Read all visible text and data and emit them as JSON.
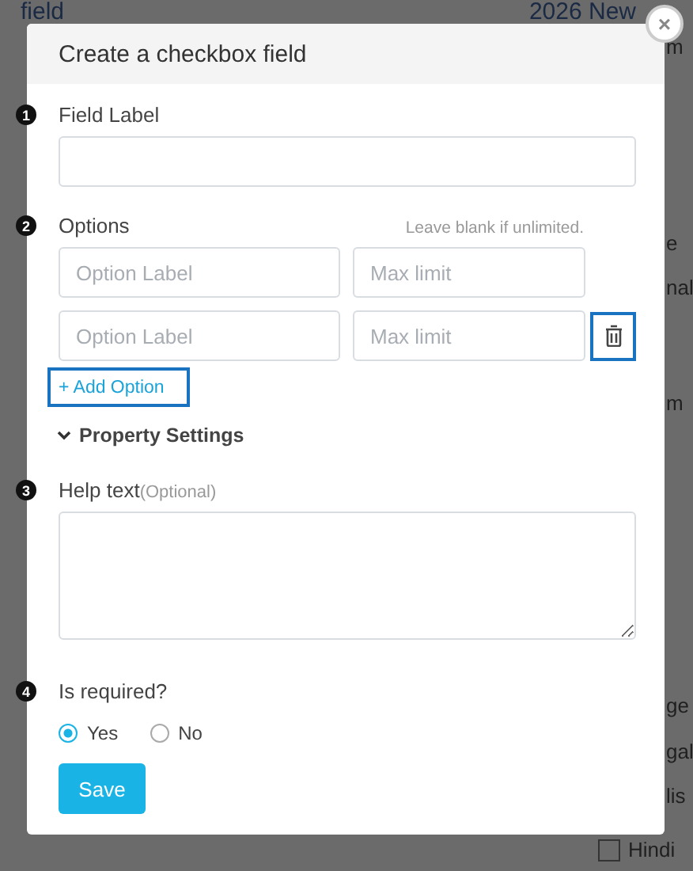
{
  "background": {
    "left_title": "field",
    "right_title": "2026 New",
    "fragments": [
      "m",
      "e",
      "nal",
      "m",
      "ge",
      "gal",
      "lis"
    ],
    "checkbox_item": {
      "label": "Hindi",
      "checked": false
    }
  },
  "modal": {
    "title": "Create a checkbox field",
    "close": "×",
    "sections": [
      {
        "number": "1",
        "label": "Field Label",
        "field": {
          "kind": "input"
        }
      },
      {
        "number": "2",
        "label": "Options",
        "hint": "Leave blank if unlimited."
      },
      {
        "number": "3",
        "label": "Help text",
        "optional": "(Optional)",
        "field": {
          "kind": "textarea"
        }
      },
      {
        "number": "4",
        "label": "Is required?"
      }
    ],
    "options": [
      {
        "label_placeholder": "Option Label",
        "limit_placeholder": "Max limit",
        "removable": false
      },
      {
        "label_placeholder": "Option Label",
        "limit_placeholder": "Max limit",
        "removable": true
      }
    ],
    "add_option": "+ Add Option",
    "property_settings": {
      "label": "Property Settings",
      "expanded": true
    },
    "required_choices": [
      {
        "label": "Yes",
        "selected": true
      },
      {
        "label": "No",
        "selected": false
      }
    ],
    "save": "Save"
  }
}
